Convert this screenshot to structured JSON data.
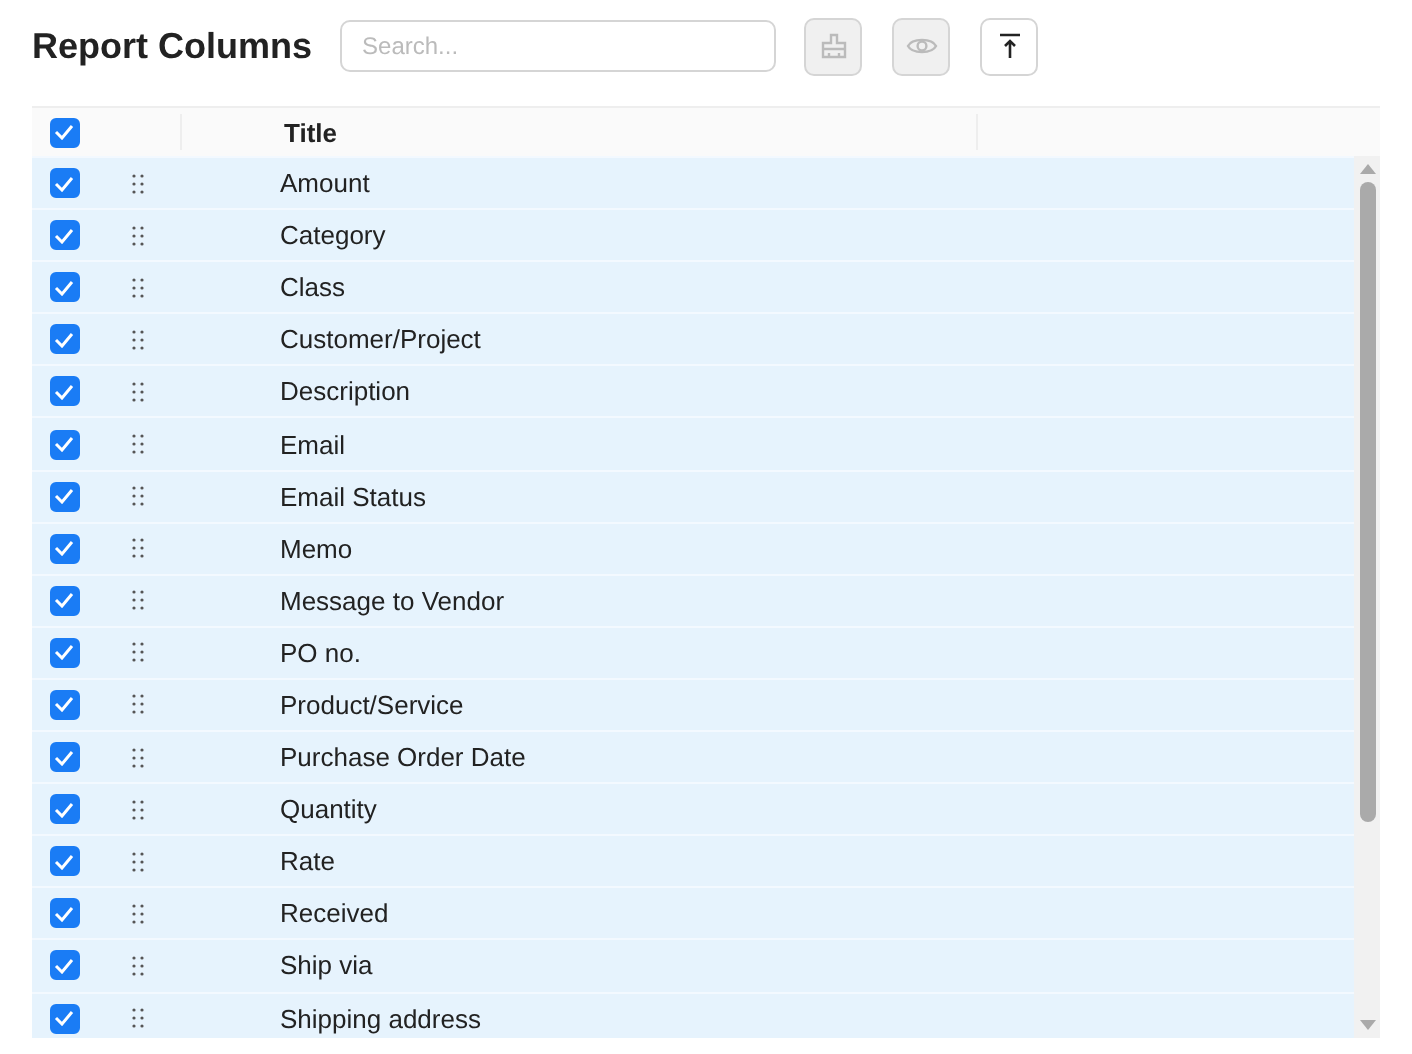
{
  "header": {
    "title": "Report Columns",
    "search": {
      "placeholder": "Search..."
    },
    "buttons": [
      {
        "kind": "brush",
        "disabled": true
      },
      {
        "kind": "eye",
        "disabled": true
      },
      {
        "kind": "top",
        "disabled": false
      }
    ]
  },
  "table": {
    "all_checked": true,
    "columns": [
      "Title"
    ],
    "rows": [
      {
        "title": "Amount",
        "checked": true
      },
      {
        "title": "Category",
        "checked": true
      },
      {
        "title": "Class",
        "checked": true
      },
      {
        "title": "Customer/Project",
        "checked": true
      },
      {
        "title": "Description",
        "checked": true
      },
      {
        "title": "Email",
        "checked": true
      },
      {
        "title": "Email Status",
        "checked": true
      },
      {
        "title": "Memo",
        "checked": true
      },
      {
        "title": "Message to Vendor",
        "checked": true
      },
      {
        "title": "PO no.",
        "checked": true
      },
      {
        "title": "Product/Service",
        "checked": true
      },
      {
        "title": "Purchase Order Date",
        "checked": true
      },
      {
        "title": "Quantity",
        "checked": true
      },
      {
        "title": "Rate",
        "checked": true
      },
      {
        "title": "Received",
        "checked": true
      },
      {
        "title": "Ship via",
        "checked": true
      },
      {
        "title": "Shipping address",
        "checked": true
      }
    ]
  }
}
